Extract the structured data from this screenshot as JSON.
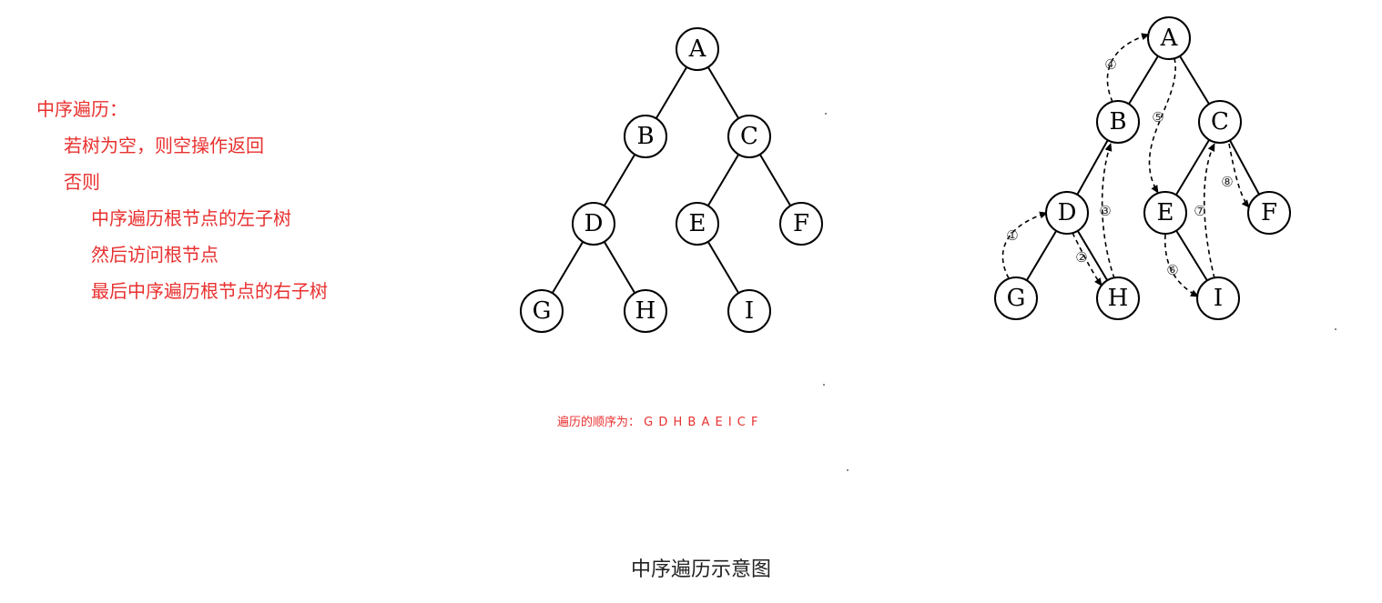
{
  "algorithm": {
    "title": "中序遍历：",
    "lines": [
      "若树为空，则空操作返回",
      "否则",
      "中序遍历根节点的左子树",
      "然后访问根节点",
      "最后中序遍历根节点的右子树"
    ]
  },
  "tree": {
    "nodes": [
      "A",
      "B",
      "C",
      "D",
      "E",
      "F",
      "G",
      "H",
      "I"
    ],
    "edges": [
      [
        "A",
        "B"
      ],
      [
        "A",
        "C"
      ],
      [
        "B",
        "D"
      ],
      [
        "C",
        "E"
      ],
      [
        "C",
        "F"
      ],
      [
        "D",
        "G"
      ],
      [
        "D",
        "H"
      ],
      [
        "E",
        "I"
      ]
    ]
  },
  "traversal_steps": [
    "①",
    "②",
    "③",
    "④",
    "⑤",
    "⑥",
    "⑦",
    "⑧"
  ],
  "order": {
    "label": "遍历的顺序为：",
    "sequence": "G D H B A E I C F"
  },
  "caption": "中序遍历示意图"
}
